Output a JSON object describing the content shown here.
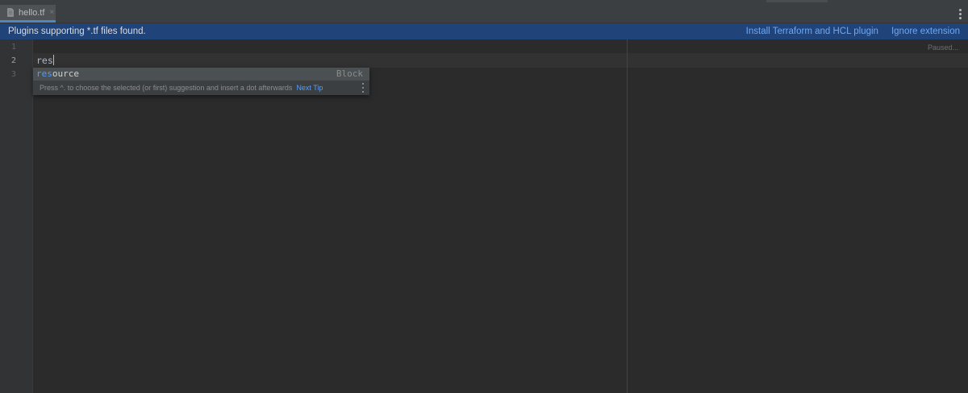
{
  "tab": {
    "label": "hello.tf",
    "close": "×"
  },
  "banner": {
    "message": "Plugins supporting *.tf files found.",
    "actions": [
      "Install Terraform and HCL plugin",
      "Ignore extension"
    ]
  },
  "editor": {
    "line_numbers": [
      "1",
      "2",
      "3"
    ],
    "current_line": "2",
    "typed_text": "res",
    "status": "Paused..."
  },
  "completion": {
    "item_match": "res",
    "item_rest": "ource",
    "item_type": "Block",
    "hint": "Press ^. to choose the selected (or first) suggestion and insert a dot afterwards",
    "next_tip": "Next Tip"
  },
  "colors": {
    "banner_bg": "#204379",
    "link": "#6fa8f3",
    "match": "#589df6",
    "editor_bg": "#2b2b2b"
  }
}
